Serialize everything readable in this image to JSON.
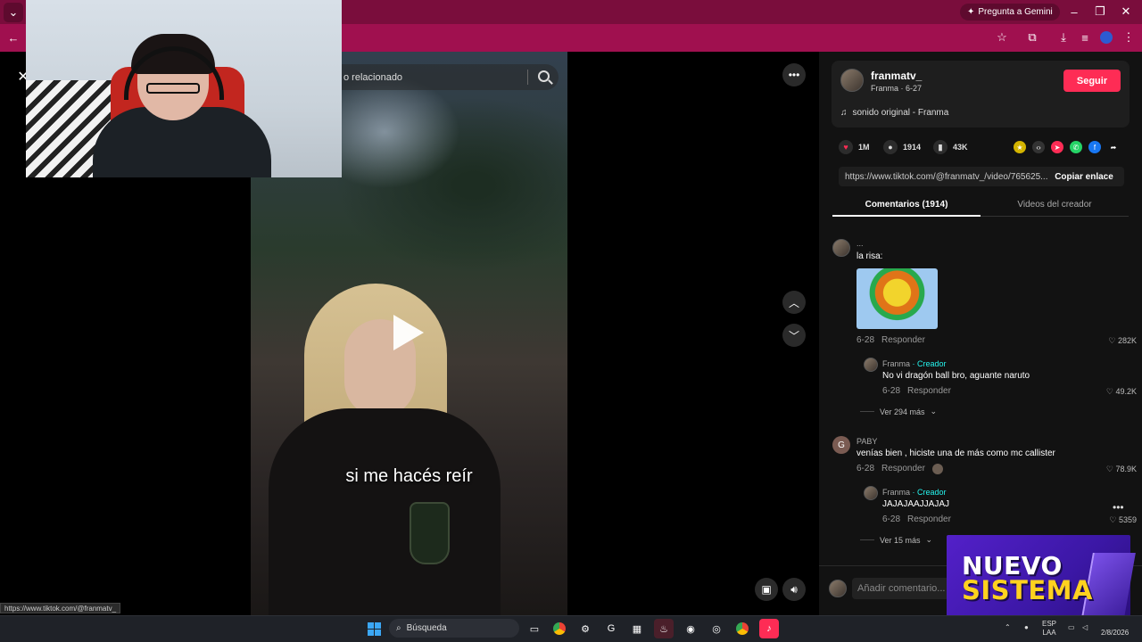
{
  "browser": {
    "gemini_label": "Pregunta a Gemini",
    "status_url": "https://www.tiktok.com/@franmatv_"
  },
  "video": {
    "search_related_text": "o relacionado",
    "caption": "si me hacés reír"
  },
  "creator": {
    "username": "franmatv_",
    "subline": "Franma · 6-27",
    "sound": "sonido original - Franma",
    "follow_label": "Seguir"
  },
  "stats": {
    "likes": "1M",
    "comments": "1914",
    "saves": "43K"
  },
  "share": {
    "link": "https://www.tiktok.com/@franmatv_/video/765625...",
    "copy_label": "Copiar enlace"
  },
  "tabs": {
    "comments": "Comentarios (1914)",
    "creator_videos": "Videos del creador"
  },
  "comments": [
    {
      "name": "...",
      "text": "la risa:",
      "date": "6-28",
      "reply_label": "Responder",
      "likes": "282K",
      "reply": {
        "name": "Franma",
        "tag": "· Creador",
        "text": "No vi dragón ball bro, aguante naruto",
        "date": "6-28",
        "reply_label": "Responder",
        "likes": "49.2K"
      },
      "more_label": "Ver 294 más"
    },
    {
      "avatar_letter": "G",
      "name": "PABY",
      "text": "venías bien , hiciste una de más como mc callister",
      "date": "6-28",
      "reply_label": "Responder",
      "likes": "78.9K",
      "reply": {
        "name": "Franma",
        "tag": "· Creador",
        "text": "JAJAJAAJJAJAJ",
        "date": "6-28",
        "reply_label": "Responder",
        "likes": "5359"
      },
      "more_label": "Ver 15 más"
    }
  ],
  "comment_input_placeholder": "Añadir comentario...",
  "promo": {
    "line1": "NUEVO",
    "line2": "SISTEMA"
  },
  "taskbar": {
    "search_label": "Búsqueda",
    "lang_top": "ESP",
    "lang_bottom": "LAA",
    "date": "2/8/2026"
  },
  "colors": {
    "browser_frame": "#a0104f",
    "follow": "#fe2c55",
    "creator_tag": "#25f4ee",
    "promo_yellow": "#ffd21f"
  }
}
